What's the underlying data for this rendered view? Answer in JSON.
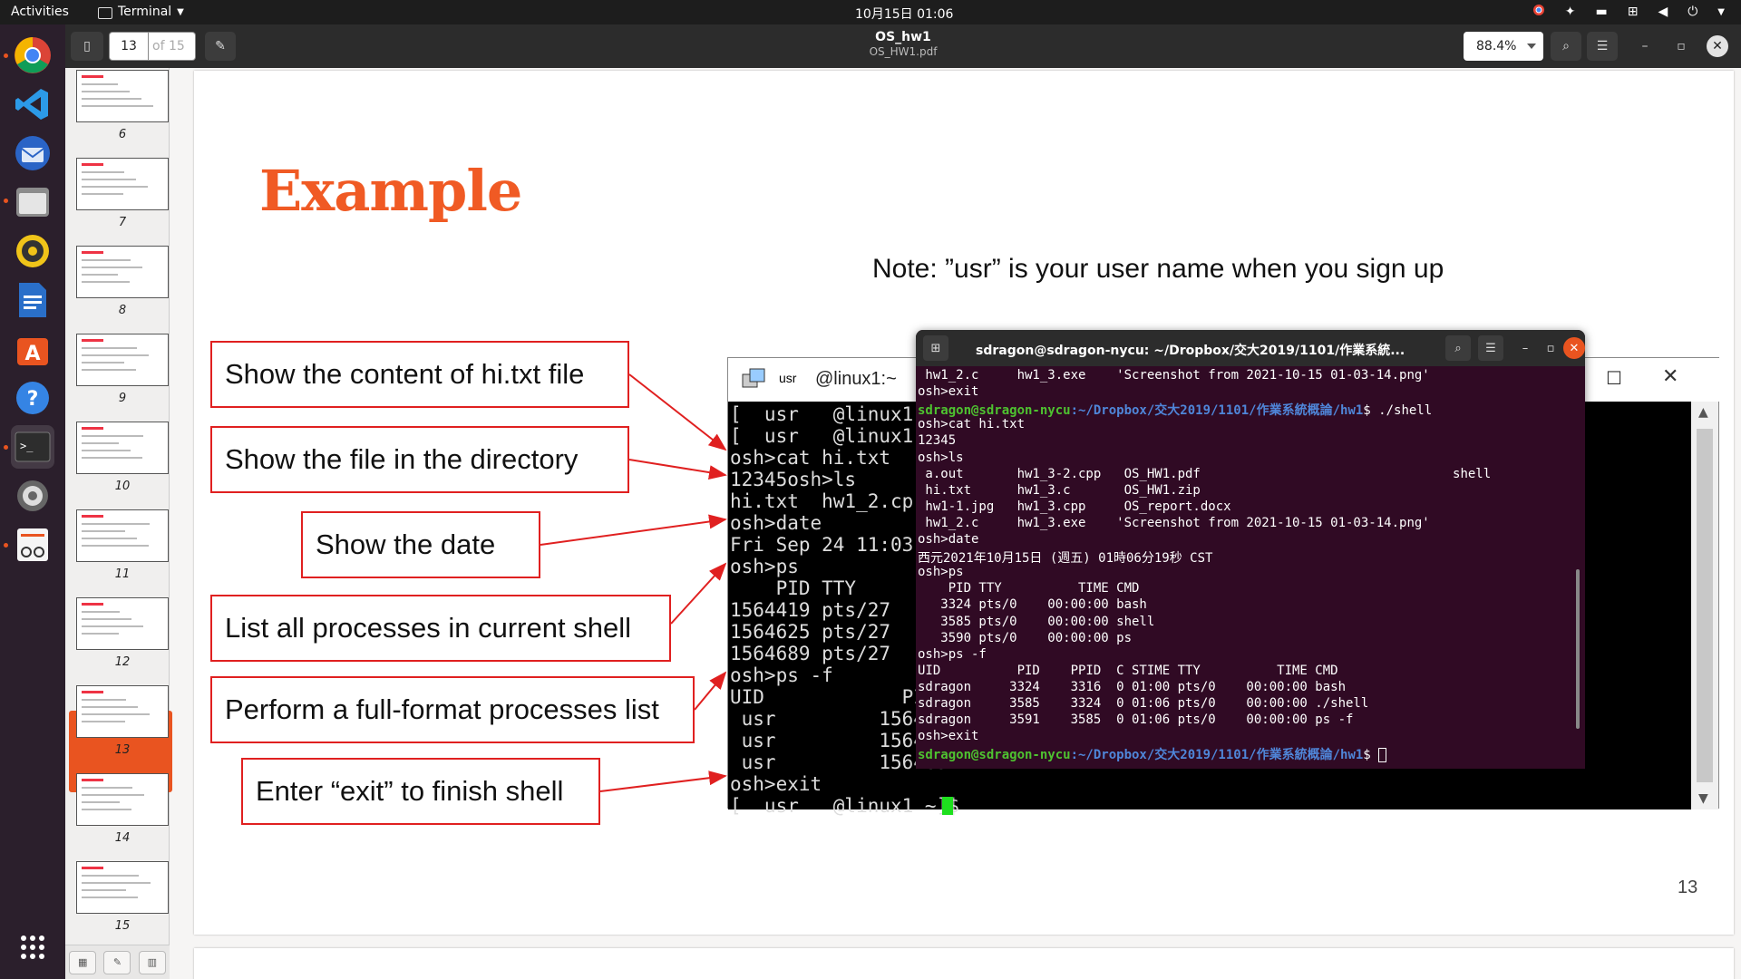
{
  "topbar": {
    "activities": "Activities",
    "app_name": "Terminal",
    "clock": "10月15日  01:06"
  },
  "dock": {
    "items": [
      "chrome-icon",
      "vscode-icon",
      "thunderbird-icon",
      "files-icon",
      "rhythmbox-icon",
      "writer-icon",
      "software-icon",
      "help-icon",
      "terminal-icon",
      "settings-icon",
      "text-editor-icon",
      "app-grid-icon"
    ]
  },
  "viewer": {
    "current_page": "13",
    "page_total": "of 15",
    "title": "OS_hw1",
    "subtitle": "OS_HW1.pdf",
    "zoom": "88.4%"
  },
  "thumbnails": [
    {
      "label": "6"
    },
    {
      "label": "7"
    },
    {
      "label": "8"
    },
    {
      "label": "9"
    },
    {
      "label": "10"
    },
    {
      "label": "11"
    },
    {
      "label": "12"
    },
    {
      "label": "13"
    },
    {
      "label": "14"
    },
    {
      "label": "15"
    }
  ],
  "slide": {
    "title": "Example",
    "note": "Note:  ”usr” is your user name when you sign up",
    "page_number": "13",
    "callouts": [
      "Show the content of hi.txt file",
      "Show the file in the directory",
      "Show the date",
      "List all processes in current shell",
      "Perform a full-format processes list",
      "Enter “exit” to finish shell"
    ]
  },
  "old_terminal": {
    "user": "usr",
    "host": "@linux1:~",
    "lines": [
      "[  usr   @linux1 ~]",
      "[  usr   @linux1 ~]",
      "osh>cat hi.txt",
      "12345osh>ls",
      "hi.txt  hw1_2.cp",
      "osh>date",
      "Fri Sep 24 11:03",
      "osh>ps",
      "    PID TTY",
      "1564419 pts/27",
      "1564625 pts/27",
      "1564689 pts/27",
      "osh>ps -f",
      "UID            PII",
      " usr         156441",
      " usr         156462",
      " usr         156469",
      "osh>exit",
      "[  usr   @linux1 ~]$ "
    ]
  },
  "new_terminal": {
    "title": "sdragon@sdragon-nycu: ~/Dropbox/交大2019/1101/作業系統...",
    "prompt_user": "sdragon@sdragon-nycu",
    "prompt_path": ":~/Dropbox/交大2019/1101/作業系統概論/hw1",
    "lines": [
      " hw1_2.c     hw1_3.exe    'Screenshot from 2021-10-15 01-03-14.png'",
      "osh>exit",
      "$ ./shell",
      "osh>cat hi.txt",
      "12345",
      "osh>ls",
      " a.out       hw1_3-2.cpp   OS_HW1.pdf                                 shell",
      " hi.txt      hw1_3.c       OS_HW1.zip",
      " hw1-1.jpg   hw1_3.cpp     OS_report.docx",
      " hw1_2.c     hw1_3.exe    'Screenshot from 2021-10-15 01-03-14.png'",
      "osh>date",
      "西元2021年10月15日 (週五) 01時06分19秒 CST",
      "osh>ps",
      "    PID TTY          TIME CMD",
      "   3324 pts/0    00:00:00 bash",
      "   3585 pts/0    00:00:00 shell",
      "   3590 pts/0    00:00:00 ps",
      "osh>ps -f",
      "UID          PID    PPID  C STIME TTY          TIME CMD",
      "sdragon     3324    3316  0 01:00 pts/0    00:00:00 bash",
      "sdragon     3585    3324  0 01:06 pts/0    00:00:00 ./shell",
      "sdragon     3591    3585  0 01:06 pts/0    00:00:00 ps -f",
      "osh>exit",
      "$ "
    ]
  },
  "colors": {
    "accent": "#e95420",
    "title_orange": "#f05a24",
    "callout_red": "#e02020",
    "terminal_bg": "#300a24"
  }
}
